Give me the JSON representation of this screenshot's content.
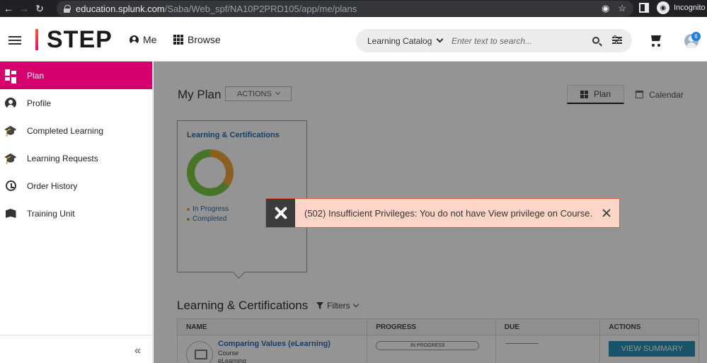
{
  "browser": {
    "url_host": "education.splunk.com",
    "url_path": "/Saba/Web_spf/NA10P2PRD105/app/me/plans",
    "profile_label": "Incognito"
  },
  "header": {
    "logo_text": "STEP",
    "me_label": "Me",
    "browse_label": "Browse",
    "catalog_label": "Learning Catalog",
    "search_placeholder": "Enter text to search...",
    "notification_count": "6"
  },
  "sidebar": {
    "items": [
      {
        "label": "Plan",
        "icon": "dashboard-icon"
      },
      {
        "label": "Profile",
        "icon": "account-circle-icon"
      },
      {
        "label": "Completed Learning",
        "icon": "graduation-cap-icon"
      },
      {
        "label": "Learning Requests",
        "icon": "graduation-cap-clock-icon"
      },
      {
        "label": "Order History",
        "icon": "history-icon"
      },
      {
        "label": "Training Unit",
        "icon": "book-icon"
      }
    ],
    "collapse_label": "«"
  },
  "main": {
    "title": "My Plan",
    "actions_label": "ACTIONS",
    "tabs": [
      {
        "label": "Plan",
        "active": true
      },
      {
        "label": "Calendar",
        "active": false
      }
    ],
    "card": {
      "title": "Learning & Certifications",
      "legend": [
        {
          "label": "In Progress",
          "color": "#f0a43c"
        },
        {
          "label": "Completed",
          "color": "#7ac943"
        }
      ]
    },
    "section_title": "Learning & Certifications",
    "filters_label": "Filters",
    "table": {
      "headers": [
        "NAME",
        "PROGRESS",
        "DUE",
        "ACTIONS"
      ],
      "rows": [
        {
          "title": "Comparing Values (eLearning)",
          "type": "Course",
          "subtype": "eLearning",
          "progress": "IN PROGRESS",
          "due": "—————",
          "action": "VIEW SUMMARY"
        }
      ]
    }
  },
  "toast": {
    "message": "(502) Insufficient Privileges: You do not have View privilege on Course.",
    "icon": "wrench-icon",
    "bg_color": "#fdd4c8",
    "border_color": "#e05b3c"
  },
  "colors": {
    "accent": "#d5006d",
    "link": "#2b6bb0",
    "button": "#2a8fb5"
  }
}
